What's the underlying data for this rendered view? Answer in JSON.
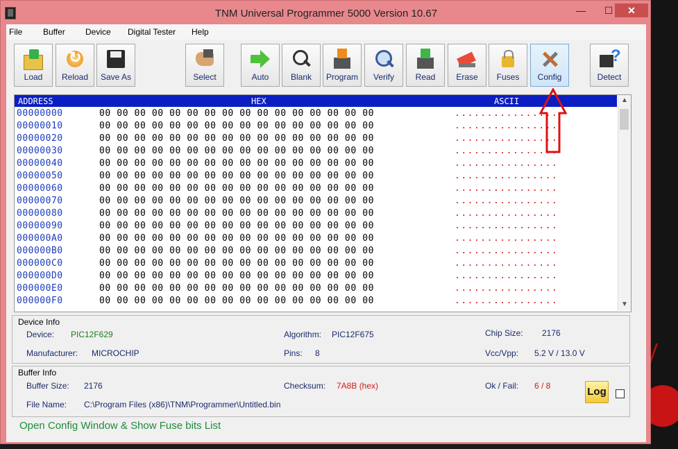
{
  "window": {
    "title": "TNM  Universal Programmer 5000   Version 10.67",
    "close_glyph": "✕",
    "max_glyph": "☐",
    "min_glyph": "—"
  },
  "menu": [
    "File",
    "Buffer",
    "Device",
    "Digital Tester",
    "Help"
  ],
  "toolbar": [
    {
      "label": "Load",
      "icon": "load-icon"
    },
    {
      "label": "Reload",
      "icon": "reload-icon"
    },
    {
      "label": "Save As",
      "icon": "save-icon"
    },
    {
      "label": "Select",
      "icon": "chip-select-icon"
    },
    {
      "label": "Auto",
      "icon": "auto-arrow-icon"
    },
    {
      "label": "Blank",
      "icon": "magnifier-icon"
    },
    {
      "label": "Program",
      "icon": "program-chip-icon"
    },
    {
      "label": "Verify",
      "icon": "verify-magnifier-icon"
    },
    {
      "label": "Read",
      "icon": "read-chip-icon"
    },
    {
      "label": "Erase",
      "icon": "eraser-icon"
    },
    {
      "label": "Fuses",
      "icon": "lock-icon"
    },
    {
      "label": "Config",
      "icon": "tools-icon"
    },
    {
      "label": "Detect",
      "icon": "detect-chip-icon"
    }
  ],
  "hex": {
    "headers": {
      "address": "ADDRESS",
      "hex": "HEX",
      "ascii": "ASCII"
    },
    "rows": [
      {
        "addr": "00000000",
        "bytes": "00 00 00 00 00 00 00 00 00 00 00 00 00 00 00 00",
        "ascii": "................"
      },
      {
        "addr": "00000010",
        "bytes": "00 00 00 00 00 00 00 00 00 00 00 00 00 00 00 00",
        "ascii": "................"
      },
      {
        "addr": "00000020",
        "bytes": "00 00 00 00 00 00 00 00 00 00 00 00 00 00 00 00",
        "ascii": "................"
      },
      {
        "addr": "00000030",
        "bytes": "00 00 00 00 00 00 00 00 00 00 00 00 00 00 00 00",
        "ascii": "................"
      },
      {
        "addr": "00000040",
        "bytes": "00 00 00 00 00 00 00 00 00 00 00 00 00 00 00 00",
        "ascii": "................"
      },
      {
        "addr": "00000050",
        "bytes": "00 00 00 00 00 00 00 00 00 00 00 00 00 00 00 00",
        "ascii": "................"
      },
      {
        "addr": "00000060",
        "bytes": "00 00 00 00 00 00 00 00 00 00 00 00 00 00 00 00",
        "ascii": "................"
      },
      {
        "addr": "00000070",
        "bytes": "00 00 00 00 00 00 00 00 00 00 00 00 00 00 00 00",
        "ascii": "................"
      },
      {
        "addr": "00000080",
        "bytes": "00 00 00 00 00 00 00 00 00 00 00 00 00 00 00 00",
        "ascii": "................"
      },
      {
        "addr": "00000090",
        "bytes": "00 00 00 00 00 00 00 00 00 00 00 00 00 00 00 00",
        "ascii": "................"
      },
      {
        "addr": "000000A0",
        "bytes": "00 00 00 00 00 00 00 00 00 00 00 00 00 00 00 00",
        "ascii": "................"
      },
      {
        "addr": "000000B0",
        "bytes": "00 00 00 00 00 00 00 00 00 00 00 00 00 00 00 00",
        "ascii": "................"
      },
      {
        "addr": "000000C0",
        "bytes": "00 00 00 00 00 00 00 00 00 00 00 00 00 00 00 00",
        "ascii": "................"
      },
      {
        "addr": "000000D0",
        "bytes": "00 00 00 00 00 00 00 00 00 00 00 00 00 00 00 00",
        "ascii": "................"
      },
      {
        "addr": "000000E0",
        "bytes": "00 00 00 00 00 00 00 00 00 00 00 00 00 00 00 00",
        "ascii": "................"
      },
      {
        "addr": "000000F0",
        "bytes": "00 00 00 00 00 00 00 00 00 00 00 00 00 00 00 00",
        "ascii": "................"
      }
    ],
    "scroll_up": "▲",
    "scroll_down": "▼"
  },
  "device_info": {
    "title": "Device Info",
    "device_label": "Device:",
    "device": "PIC12F629",
    "algorithm_label": "Algorithm:",
    "algorithm": "PIC12F675",
    "chip_size_label": "Chip Size:",
    "chip_size": "2176",
    "manufacturer_label": "Manufacturer:",
    "manufacturer": "MICROCHIP",
    "pins_label": "Pins:",
    "pins": "8",
    "vcc_label": "Vcc/Vpp:",
    "vcc": "5.2 V / 13.0 V"
  },
  "buffer_info": {
    "title": "Buffer Info",
    "size_label": "Buffer Size:",
    "size": "2176",
    "checksum_label": "Checksum:",
    "checksum": "7A8B (hex)",
    "okfail_label": "Ok / Fail:",
    "okfail": "6 / 8",
    "filename_label": "File Name:",
    "filename": "C:\\Program Files (x86)\\TNM\\Programmer\\Untitled.bin"
  },
  "log_label": "Log",
  "status": "Open Config Window & Show Fuse bits List",
  "colors": {
    "title_bar": "#e8888c",
    "hex_header": "#0b1ec2",
    "address": "#1b3bbd",
    "ascii": "#d01a1a",
    "status": "#1e8a3a",
    "arrow": "#e01010"
  }
}
